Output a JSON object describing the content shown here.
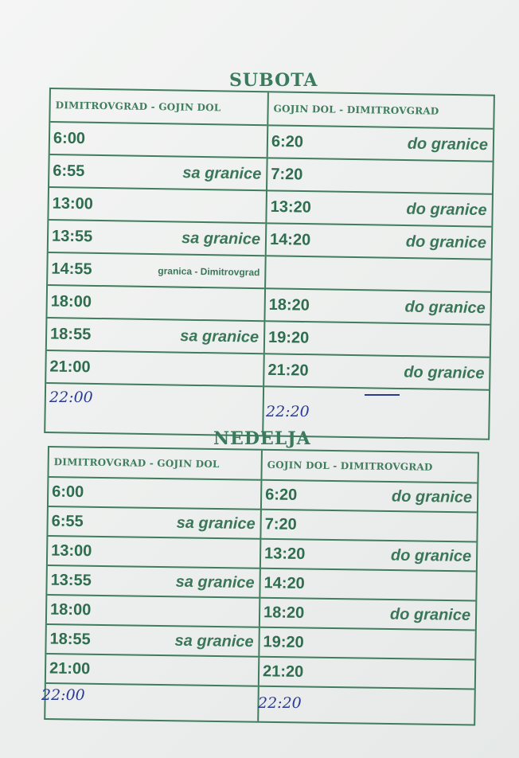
{
  "subota": {
    "title": "SUBOTA",
    "left_header": "DIMITROVGRAD - GOJIN DOL",
    "right_header": "GOJIN DOL - DIMITROVGRAD",
    "left_rows": [
      {
        "time": "6:00",
        "note": ""
      },
      {
        "time": "6:55",
        "note": "sa granice"
      },
      {
        "time": "13:00",
        "note": ""
      },
      {
        "time": "13:55",
        "note": "sa granice"
      },
      {
        "time": "14:55",
        "note": "granica - Dimitrovgrad"
      },
      {
        "time": "18:00",
        "note": ""
      },
      {
        "time": "18:55",
        "note": "sa granice"
      },
      {
        "time": "21:00",
        "note": ""
      }
    ],
    "right_rows": [
      {
        "time": "6:20",
        "note": "do granice"
      },
      {
        "time": "7:20",
        "note": ""
      },
      {
        "time": "13:20",
        "note": "do granice"
      },
      {
        "time": "14:20",
        "note": "do granice"
      },
      {
        "time": "",
        "note": ""
      },
      {
        "time": "18:20",
        "note": "do granice"
      },
      {
        "time": "19:20",
        "note": ""
      },
      {
        "time": "21:20",
        "note": "do granice"
      }
    ],
    "handwritten_left": "22:00",
    "handwritten_right": "22:20"
  },
  "nedelja": {
    "title": "NEDELJA",
    "left_header": "DIMITROVGRAD - GOJIN DOL",
    "right_header": "GOJIN DOL - DIMITROVGRAD",
    "left_rows": [
      {
        "time": "6:00",
        "note": ""
      },
      {
        "time": "6:55",
        "note": "sa granice"
      },
      {
        "time": "13:00",
        "note": ""
      },
      {
        "time": "13:55",
        "note": "sa granice"
      },
      {
        "time": "18:00",
        "note": ""
      },
      {
        "time": "18:55",
        "note": "sa granice"
      },
      {
        "time": "21:00",
        "note": ""
      }
    ],
    "right_rows": [
      {
        "time": "6:20",
        "note": "do granice"
      },
      {
        "time": "7:20",
        "note": ""
      },
      {
        "time": "13:20",
        "note": "do granice"
      },
      {
        "time": "14:20",
        "note": ""
      },
      {
        "time": "18:20",
        "note": "do granice"
      },
      {
        "time": "19:20",
        "note": ""
      },
      {
        "time": "21:20",
        "note": ""
      }
    ],
    "handwritten_left": "22:00",
    "handwritten_right": "22:20"
  }
}
